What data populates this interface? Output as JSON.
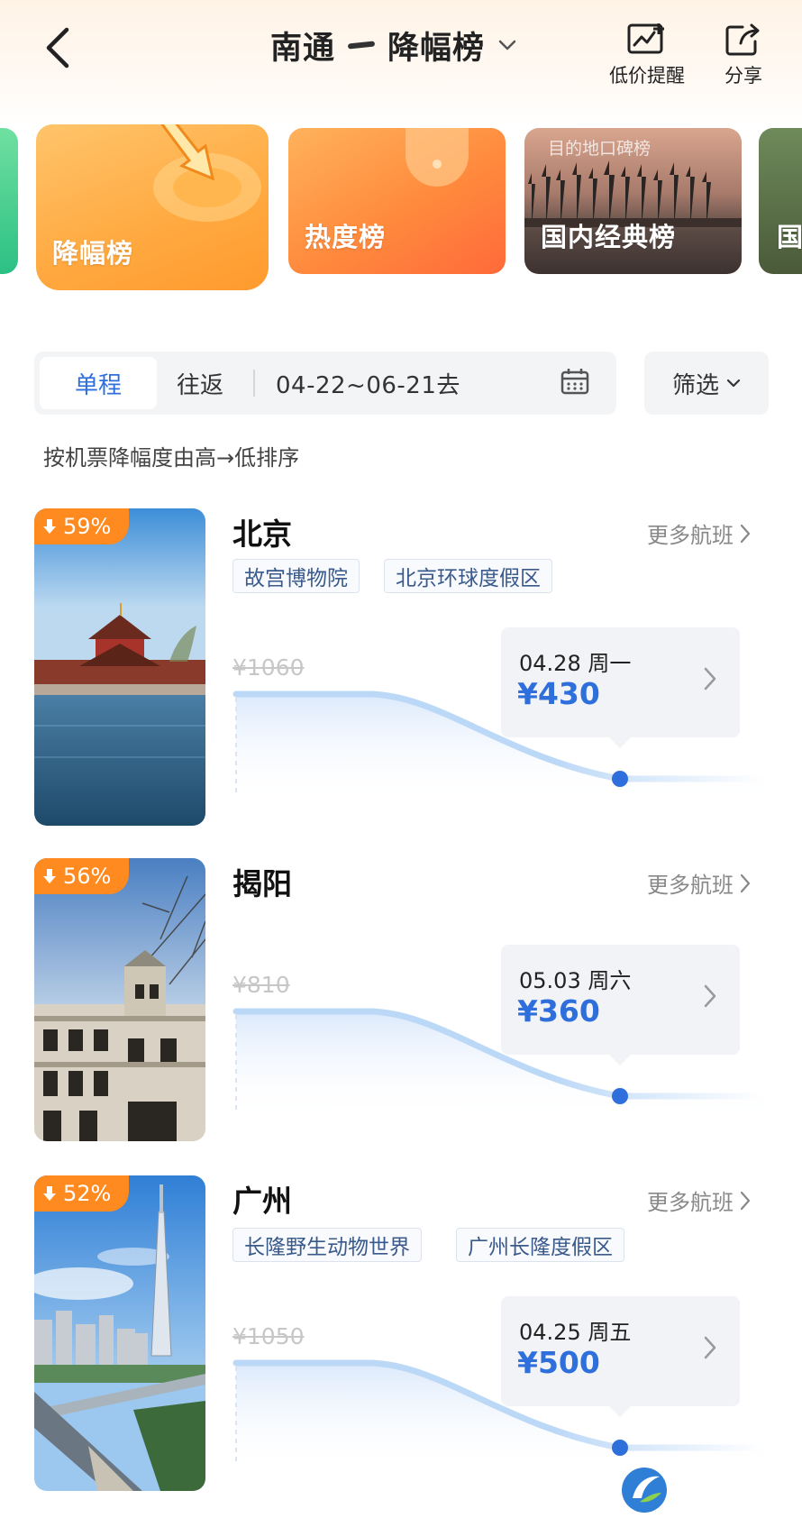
{
  "header": {
    "origin": "南通",
    "list_name": "降幅榜",
    "alert_label": "低价提醒",
    "share_label": "分享"
  },
  "categories": [
    {
      "label": "降幅榜",
      "active": true
    },
    {
      "label": "热度榜",
      "active": false
    },
    {
      "label": "国内经典榜",
      "active": false,
      "overlay_text": "目的地口碑榜"
    },
    {
      "label": "国",
      "active": false
    }
  ],
  "search": {
    "one_way": "单程",
    "round_trip": "往返",
    "date_range": "04-22~06-21去",
    "filter": "筛选"
  },
  "sort_note": "按机票降幅度由高→低排序",
  "more_flights_label": "更多航班",
  "destinations": [
    {
      "drop": "59%",
      "city": "北京",
      "tags": [
        "故宫博物院",
        "北京环球度假区"
      ],
      "original_price": "¥1060",
      "date": "04.28 周一",
      "price": "¥430"
    },
    {
      "drop": "56%",
      "city": "揭阳",
      "tags": [],
      "original_price": "¥810",
      "date": "05.03 周六",
      "price": "¥360"
    },
    {
      "drop": "52%",
      "city": "广州",
      "tags": [
        "长隆野生动物世界",
        "广州长隆度假区"
      ],
      "original_price": "¥1050",
      "date": "04.25 周五",
      "price": "¥500"
    }
  ],
  "colors": {
    "accent_blue": "#2e6fdc",
    "badge_orange": "#ff8a1f"
  }
}
